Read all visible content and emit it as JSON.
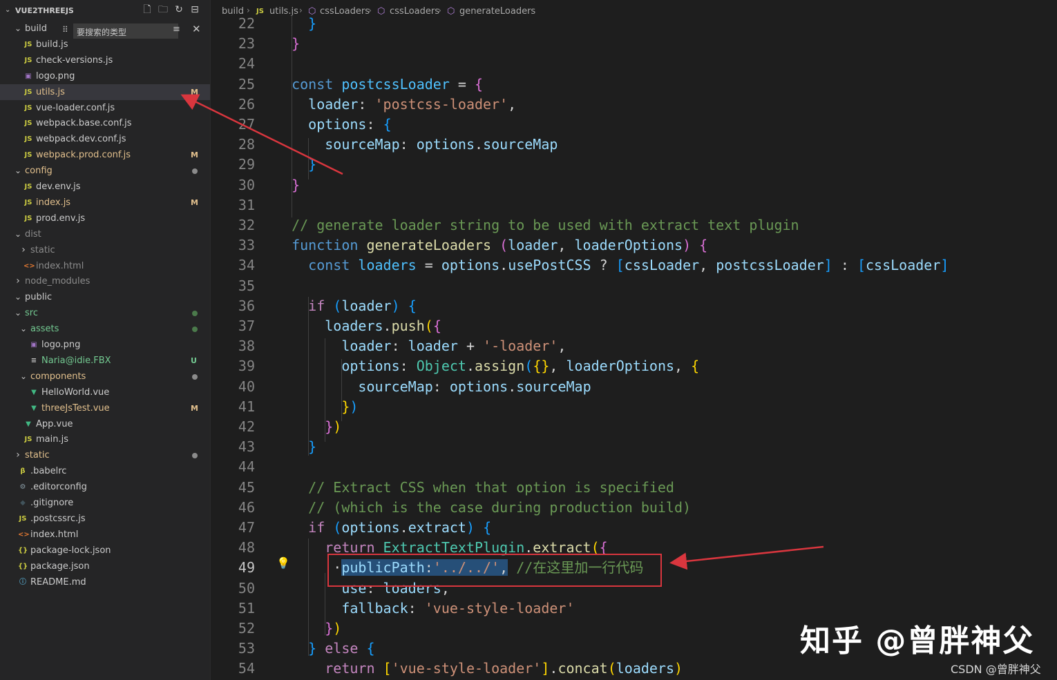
{
  "sidebar": {
    "title": "VUE2THREEJS",
    "filter_placeholder": "要搜索的类型",
    "items": [
      {
        "label": "build",
        "kind": "folder-open",
        "depth": 0,
        "color": "#cccccc"
      },
      {
        "label": "build.js",
        "kind": "js",
        "depth": 1,
        "color": "#cccccc"
      },
      {
        "label": "check-versions.js",
        "kind": "js",
        "depth": 1,
        "color": "#cccccc"
      },
      {
        "label": "logo.png",
        "kind": "img",
        "depth": 1,
        "color": "#cccccc"
      },
      {
        "label": "utils.js",
        "kind": "js",
        "depth": 1,
        "color": "#e2c08d",
        "badge": "M",
        "selected": true
      },
      {
        "label": "vue-loader.conf.js",
        "kind": "js",
        "depth": 1,
        "color": "#cccccc"
      },
      {
        "label": "webpack.base.conf.js",
        "kind": "js",
        "depth": 1,
        "color": "#cccccc"
      },
      {
        "label": "webpack.dev.conf.js",
        "kind": "js",
        "depth": 1,
        "color": "#cccccc"
      },
      {
        "label": "webpack.prod.conf.js",
        "kind": "js",
        "depth": 1,
        "color": "#e2c08d",
        "badge": "M"
      },
      {
        "label": "config",
        "kind": "folder-open",
        "depth": 0,
        "color": "#e2c08d",
        "dot": "#8b8b8b"
      },
      {
        "label": "dev.env.js",
        "kind": "js",
        "depth": 1,
        "color": "#cccccc"
      },
      {
        "label": "index.js",
        "kind": "js",
        "depth": 1,
        "color": "#e2c08d",
        "badge": "M"
      },
      {
        "label": "prod.env.js",
        "kind": "js",
        "depth": 1,
        "color": "#cccccc"
      },
      {
        "label": "dist",
        "kind": "folder-open",
        "depth": 0,
        "color": "#8c8c8c"
      },
      {
        "label": "static",
        "kind": "folder-closed",
        "depth": 1,
        "color": "#8c8c8c"
      },
      {
        "label": "index.html",
        "kind": "html",
        "depth": 1,
        "color": "#8c8c8c"
      },
      {
        "label": "node_modules",
        "kind": "folder-closed",
        "depth": 0,
        "color": "#8c8c8c"
      },
      {
        "label": "public",
        "kind": "folder-open",
        "depth": 0,
        "color": "#cccccc"
      },
      {
        "label": "src",
        "kind": "folder-open",
        "depth": 0,
        "color": "#73c991",
        "dot": "#4b7a4b"
      },
      {
        "label": "assets",
        "kind": "folder-open",
        "depth": 1,
        "color": "#73c991",
        "dot": "#4b7a4b"
      },
      {
        "label": "logo.png",
        "kind": "img",
        "depth": 2,
        "color": "#cccccc"
      },
      {
        "label": "Naria@idie.FBX",
        "kind": "text",
        "depth": 2,
        "color": "#73c991",
        "badge": "U"
      },
      {
        "label": "components",
        "kind": "folder-open",
        "depth": 1,
        "color": "#e2c08d",
        "dot": "#8b8b8b"
      },
      {
        "label": "HelloWorld.vue",
        "kind": "vue",
        "depth": 2,
        "color": "#cccccc"
      },
      {
        "label": "threeJsTest.vue",
        "kind": "vue",
        "depth": 2,
        "color": "#e2c08d",
        "badge": "M"
      },
      {
        "label": "App.vue",
        "kind": "vue",
        "depth": 1,
        "color": "#cccccc"
      },
      {
        "label": "main.js",
        "kind": "js",
        "depth": 1,
        "color": "#cccccc"
      },
      {
        "label": "static",
        "kind": "folder-closed",
        "depth": 0,
        "color": "#e2c08d",
        "dot": "#8b8b8b"
      },
      {
        "label": ".babelrc",
        "kind": "babel",
        "depth": 0,
        "color": "#cccccc"
      },
      {
        "label": ".editorconfig",
        "kind": "gear",
        "depth": 0,
        "color": "#cccccc"
      },
      {
        "label": ".gitignore",
        "kind": "git",
        "depth": 0,
        "color": "#cccccc"
      },
      {
        "label": ".postcssrc.js",
        "kind": "js",
        "depth": 0,
        "color": "#cccccc"
      },
      {
        "label": "index.html",
        "kind": "html",
        "depth": 0,
        "color": "#cccccc"
      },
      {
        "label": "package-lock.json",
        "kind": "json",
        "depth": 0,
        "color": "#cccccc"
      },
      {
        "label": "package.json",
        "kind": "json",
        "depth": 0,
        "color": "#cccccc"
      },
      {
        "label": "README.md",
        "kind": "info",
        "depth": 0,
        "color": "#cccccc"
      }
    ]
  },
  "breadcrumb": {
    "items": [
      "build",
      "utils.js",
      "cssLoaders",
      "cssLoaders",
      "generateLoaders"
    ]
  },
  "editor": {
    "active_line": "49",
    "lines": [
      {
        "n": "22",
        "tokens": [
          [
            "    ",
            ""
          ],
          [
            "}",
            "b3"
          ]
        ]
      },
      {
        "n": "23",
        "tokens": [
          [
            "  ",
            ""
          ],
          [
            "}",
            "b2"
          ]
        ]
      },
      {
        "n": "24",
        "tokens": []
      },
      {
        "n": "25",
        "tokens": [
          [
            "  ",
            ""
          ],
          [
            "const ",
            "kw"
          ],
          [
            "postcssLoader",
            "const"
          ],
          [
            " = ",
            ""
          ],
          [
            "{",
            "b2"
          ]
        ]
      },
      {
        "n": "26",
        "tokens": [
          [
            "    ",
            ""
          ],
          [
            "loader",
            "var"
          ],
          [
            ": ",
            ""
          ],
          [
            "'postcss-loader'",
            "str"
          ],
          [
            ",",
            ""
          ]
        ]
      },
      {
        "n": "27",
        "tokens": [
          [
            "    ",
            ""
          ],
          [
            "options",
            "var"
          ],
          [
            ": ",
            ""
          ],
          [
            "{",
            "b3"
          ]
        ]
      },
      {
        "n": "28",
        "tokens": [
          [
            "      ",
            ""
          ],
          [
            "sourceMap",
            "var"
          ],
          [
            ": ",
            ""
          ],
          [
            "options",
            "var"
          ],
          [
            ".",
            ""
          ],
          [
            "sourceMap",
            "var"
          ]
        ]
      },
      {
        "n": "29",
        "tokens": [
          [
            "    ",
            ""
          ],
          [
            "}",
            "b3"
          ]
        ]
      },
      {
        "n": "30",
        "tokens": [
          [
            "  ",
            ""
          ],
          [
            "}",
            "b2"
          ]
        ]
      },
      {
        "n": "31",
        "tokens": []
      },
      {
        "n": "32",
        "tokens": [
          [
            "  ",
            ""
          ],
          [
            "// generate loader string to be used with extract text plugin",
            "cm"
          ]
        ]
      },
      {
        "n": "33",
        "tokens": [
          [
            "  ",
            ""
          ],
          [
            "function ",
            "kw"
          ],
          [
            "generateLoaders ",
            "fn"
          ],
          [
            "(",
            "b2"
          ],
          [
            "loader",
            "var"
          ],
          [
            ", ",
            ""
          ],
          [
            "loaderOptions",
            "var"
          ],
          [
            ")",
            "b2"
          ],
          [
            " ",
            ""
          ],
          [
            "{",
            "b2"
          ]
        ]
      },
      {
        "n": "34",
        "tokens": [
          [
            "    ",
            ""
          ],
          [
            "const ",
            "kw"
          ],
          [
            "loaders",
            "const"
          ],
          [
            " = ",
            ""
          ],
          [
            "options",
            "var"
          ],
          [
            ".",
            ""
          ],
          [
            "usePostCSS",
            "var"
          ],
          [
            " ? ",
            ""
          ],
          [
            "[",
            "b3"
          ],
          [
            "cssLoader",
            "var"
          ],
          [
            ", ",
            ""
          ],
          [
            "postcssLoader",
            "var"
          ],
          [
            "]",
            "b3"
          ],
          [
            " : ",
            ""
          ],
          [
            "[",
            "b3"
          ],
          [
            "cssLoader",
            "var"
          ],
          [
            "]",
            "b3"
          ]
        ]
      },
      {
        "n": "35",
        "tokens": []
      },
      {
        "n": "36",
        "tokens": [
          [
            "    ",
            ""
          ],
          [
            "if ",
            "kw2"
          ],
          [
            "(",
            "b3"
          ],
          [
            "loader",
            "var"
          ],
          [
            ")",
            "b3"
          ],
          [
            " ",
            ""
          ],
          [
            "{",
            "b3"
          ]
        ]
      },
      {
        "n": "37",
        "tokens": [
          [
            "      ",
            ""
          ],
          [
            "loaders",
            "var"
          ],
          [
            ".",
            ""
          ],
          [
            "push",
            "fn"
          ],
          [
            "(",
            "b1"
          ],
          [
            "{",
            "b2"
          ]
        ]
      },
      {
        "n": "38",
        "tokens": [
          [
            "        ",
            ""
          ],
          [
            "loader",
            "var"
          ],
          [
            ": ",
            ""
          ],
          [
            "loader",
            "var"
          ],
          [
            " + ",
            ""
          ],
          [
            "'-loader'",
            "str"
          ],
          [
            ",",
            ""
          ]
        ]
      },
      {
        "n": "39",
        "tokens": [
          [
            "        ",
            ""
          ],
          [
            "options",
            "var"
          ],
          [
            ": ",
            ""
          ],
          [
            "Object",
            "cls"
          ],
          [
            ".",
            ""
          ],
          [
            "assign",
            "fn"
          ],
          [
            "(",
            "b3"
          ],
          [
            "{}",
            "b1"
          ],
          [
            ", ",
            ""
          ],
          [
            "loaderOptions",
            "var"
          ],
          [
            ", ",
            ""
          ],
          [
            "{",
            "b1"
          ]
        ]
      },
      {
        "n": "40",
        "tokens": [
          [
            "          ",
            ""
          ],
          [
            "sourceMap",
            "var"
          ],
          [
            ": ",
            ""
          ],
          [
            "options",
            "var"
          ],
          [
            ".",
            ""
          ],
          [
            "sourceMap",
            "var"
          ]
        ]
      },
      {
        "n": "41",
        "tokens": [
          [
            "        ",
            ""
          ],
          [
            "}",
            "b1"
          ],
          [
            ")",
            "b3"
          ]
        ]
      },
      {
        "n": "42",
        "tokens": [
          [
            "      ",
            ""
          ],
          [
            "}",
            "b2"
          ],
          [
            ")",
            "b1"
          ]
        ]
      },
      {
        "n": "43",
        "tokens": [
          [
            "    ",
            ""
          ],
          [
            "}",
            "b3"
          ]
        ]
      },
      {
        "n": "44",
        "tokens": []
      },
      {
        "n": "45",
        "tokens": [
          [
            "    ",
            ""
          ],
          [
            "// Extract CSS when that option is specified",
            "cm"
          ]
        ]
      },
      {
        "n": "46",
        "tokens": [
          [
            "    ",
            ""
          ],
          [
            "// (which is the case during production build)",
            "cm"
          ]
        ]
      },
      {
        "n": "47",
        "tokens": [
          [
            "    ",
            ""
          ],
          [
            "if ",
            "kw2"
          ],
          [
            "(",
            "b3"
          ],
          [
            "options",
            "var"
          ],
          [
            ".",
            ""
          ],
          [
            "extract",
            "var"
          ],
          [
            ")",
            "b3"
          ],
          [
            " ",
            ""
          ],
          [
            "{",
            "b3"
          ]
        ]
      },
      {
        "n": "48",
        "tokens": [
          [
            "      ",
            ""
          ],
          [
            "return ",
            "kw2"
          ],
          [
            "ExtractTextPlugin",
            "cls"
          ],
          [
            ".",
            ""
          ],
          [
            "extract",
            "fn"
          ],
          [
            "(",
            "b1"
          ],
          [
            "{",
            "b2"
          ]
        ]
      },
      {
        "n": "49",
        "tokens": [
          [
            "       ",
            ""
          ],
          [
            "·",
            ""
          ],
          [
            "publicPath",
            "var hl-sel"
          ],
          [
            ":",
            "hl-sel"
          ],
          [
            "'../../'",
            "str hl-sel"
          ],
          [
            ",",
            "hl-sel"
          ],
          [
            " ",
            ""
          ],
          [
            "//在这里加一行代码",
            "cm"
          ]
        ]
      },
      {
        "n": "50",
        "tokens": [
          [
            "        ",
            ""
          ],
          [
            "use",
            "var"
          ],
          [
            ": ",
            ""
          ],
          [
            "loaders",
            "var"
          ],
          [
            ",",
            ""
          ]
        ]
      },
      {
        "n": "51",
        "tokens": [
          [
            "        ",
            ""
          ],
          [
            "fallback",
            "var"
          ],
          [
            ": ",
            ""
          ],
          [
            "'vue-style-loader'",
            "str"
          ]
        ]
      },
      {
        "n": "52",
        "tokens": [
          [
            "      ",
            ""
          ],
          [
            "}",
            "b2"
          ],
          [
            ")",
            "b1"
          ]
        ]
      },
      {
        "n": "53",
        "tokens": [
          [
            "    ",
            ""
          ],
          [
            "}",
            "b3"
          ],
          [
            " else ",
            "kw2"
          ],
          [
            "{",
            "b3"
          ]
        ]
      },
      {
        "n": "54",
        "tokens": [
          [
            "      ",
            ""
          ],
          [
            "return ",
            "kw2"
          ],
          [
            "[",
            "b1"
          ],
          [
            "'vue-style-loader'",
            "str"
          ],
          [
            "]",
            "b1"
          ],
          [
            ".",
            ""
          ],
          [
            "concat",
            "fn"
          ],
          [
            "(",
            "b1"
          ],
          [
            "loaders",
            "var"
          ],
          [
            ")",
            "b1"
          ]
        ]
      }
    ]
  },
  "watermark": {
    "zhihu": "知乎 @曾胖神父",
    "csdn": "CSDN @曾胖神父"
  },
  "colors": {
    "annotation_red": "#d9363e"
  }
}
